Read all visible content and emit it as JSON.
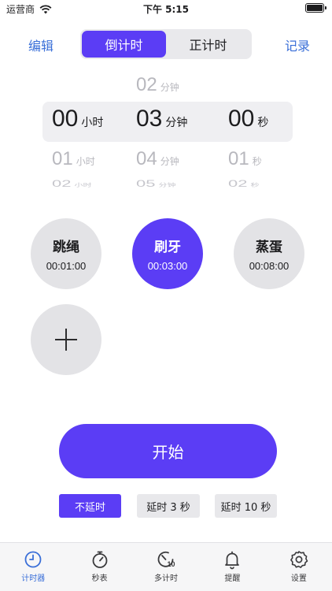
{
  "status_bar": {
    "carrier": "运营商",
    "time": "下午 5:15"
  },
  "header": {
    "edit": "编辑",
    "record": "记录",
    "tabs": [
      {
        "label": "倒计时",
        "active": true
      },
      {
        "label": "正计时",
        "active": false
      }
    ]
  },
  "picker": {
    "hours": {
      "unit": "小时",
      "prev": "",
      "selected": "00",
      "next": "01",
      "next2": "02"
    },
    "minutes": {
      "unit": "分钟",
      "prev": "02",
      "selected": "03",
      "next": "04",
      "next2": "05"
    },
    "seconds": {
      "unit": "秒",
      "prev": "",
      "selected": "00",
      "next": "01",
      "next2": "02"
    }
  },
  "presets": [
    {
      "name": "跳绳",
      "time": "00:01:00",
      "active": false
    },
    {
      "name": "刷牙",
      "time": "00:03:00",
      "active": true
    },
    {
      "name": "蒸蛋",
      "time": "00:08:00",
      "active": false
    }
  ],
  "start_label": "开始",
  "delay_options": [
    {
      "label": "不延时",
      "active": true
    },
    {
      "label": "延时 3 秒",
      "active": false
    },
    {
      "label": "延时 10 秒",
      "active": false
    }
  ],
  "tab_bar": [
    {
      "label": "计时器",
      "icon": "timer-icon",
      "active": true
    },
    {
      "label": "秒表",
      "icon": "stopwatch-icon",
      "active": false
    },
    {
      "label": "多计时",
      "icon": "multi-timer-icon",
      "active": false
    },
    {
      "label": "提醒",
      "icon": "bell-icon",
      "active": false
    },
    {
      "label": "设置",
      "icon": "gear-icon",
      "active": false
    }
  ],
  "colors": {
    "accent": "#5b3df5",
    "link": "#3a6fd8",
    "inactive_bg": "#e3e3e6"
  }
}
